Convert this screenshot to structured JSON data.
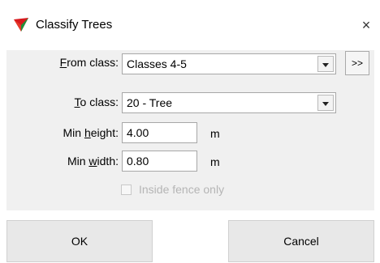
{
  "window": {
    "title": "Classify Trees",
    "close_glyph": "×"
  },
  "form": {
    "from_class": {
      "label_prefix": "",
      "label_accel": "F",
      "label_rest": "rom class:",
      "value": "Classes 4-5"
    },
    "to_class": {
      "label_prefix": "",
      "label_accel": "T",
      "label_rest": "o class:",
      "value": "20 - Tree"
    },
    "more_button": ">>",
    "min_height": {
      "label_prefix": "Min ",
      "label_accel": "h",
      "label_rest": "eight:",
      "value": "4.00",
      "unit": "m"
    },
    "min_width": {
      "label_prefix": "Min ",
      "label_accel": "w",
      "label_rest": "idth:",
      "value": "0.80",
      "unit": "m"
    },
    "inside_fence": {
      "label": "Inside fence only",
      "checked": false,
      "enabled": false
    }
  },
  "buttons": {
    "ok": "OK",
    "cancel": "Cancel"
  },
  "icons": {
    "app": "tree-classify-icon",
    "close": "close-icon",
    "dropdown": "chevron-down-icon"
  }
}
